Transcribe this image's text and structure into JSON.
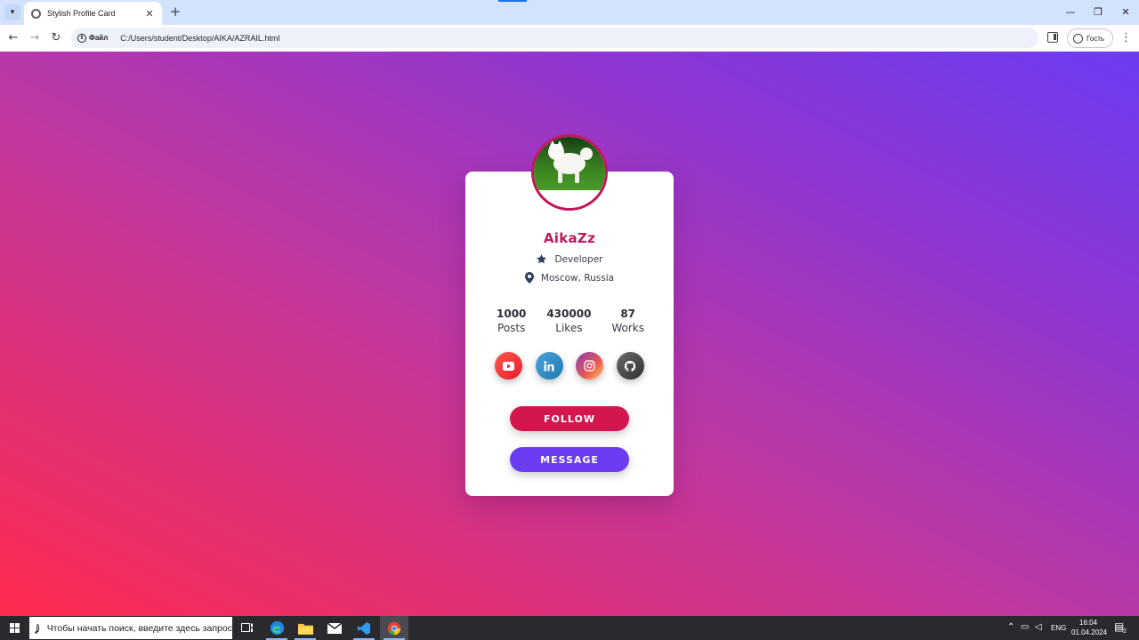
{
  "browser": {
    "tab_title": "Stylish Profile Card",
    "tab_close": "✕",
    "new_tab": "+",
    "chip_label": "Файл",
    "url": "C:/Users/student/Desktop/AIKA/AZRAIL.html",
    "profile_label": "Гость",
    "window_controls": {
      "minimize": "—",
      "restore": "❐",
      "close": "✕"
    }
  },
  "profile": {
    "name": "AikaZz",
    "role": "Developer",
    "role_icon": "star-icon",
    "location": "Moscow, Russia",
    "location_icon": "map-pin-icon",
    "stats": [
      {
        "value": "1000",
        "label": "Posts"
      },
      {
        "value": "430000",
        "label": "Likes"
      },
      {
        "value": "87",
        "label": "Works"
      }
    ],
    "socials": [
      {
        "icon": "youtube-icon",
        "color": "#e5192c"
      },
      {
        "icon": "linkedin-icon",
        "color": "#1f7ab3"
      },
      {
        "icon": "instagram-icon",
        "color": "#e95950"
      },
      {
        "icon": "github-icon",
        "color": "#2f2f2f"
      }
    ],
    "follow_label": "FOLLOW",
    "message_label": "MESSAGE",
    "accent": "#c2185b",
    "follow_color": "#d4164f",
    "message_color": "#6b3cf2"
  },
  "taskbar": {
    "search_placeholder": "Чтобы начать поиск, введите здесь запрос",
    "language": "ENG",
    "time": "16:04",
    "date": "01.04.2024",
    "notification_count": "2",
    "apps": [
      "task-view-icon",
      "edge-icon",
      "file-explorer-icon",
      "mail-icon",
      "vscode-icon",
      "chrome-icon"
    ]
  }
}
